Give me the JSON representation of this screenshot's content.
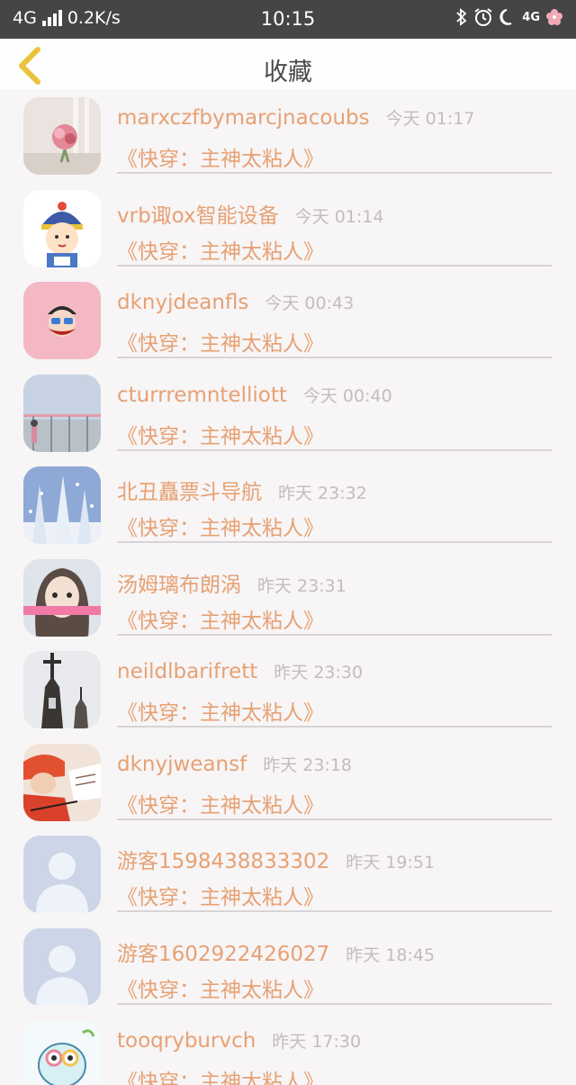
{
  "status_bar": {
    "network": "4G",
    "speed": "0.2K/s",
    "time": "10:15",
    "right_badge": "4G",
    "icons": [
      "bluetooth-icon",
      "alarm-icon",
      "moon-icon",
      "signal-4g-icon",
      "flower-icon"
    ]
  },
  "header": {
    "title": "收藏",
    "back_icon": "chevron-left-icon"
  },
  "colors": {
    "accent": "#e7a174",
    "time_gray": "#c2bcbd",
    "status_bar": "#454545"
  },
  "items": [
    {
      "name": "marxczfbymarcjnacoubs",
      "time": "今天 01:17",
      "book": "《快穿：主神太粘人》",
      "avatar": "flower-bouquet"
    },
    {
      "name": "vrb诹ox智能设备",
      "time": "今天 01:14",
      "book": "《快穿：主神太粘人》",
      "avatar": "cartoon-boy"
    },
    {
      "name": "dknyjdeanfls",
      "time": "今天 00:43",
      "book": "《快穿：主神太粘人》",
      "avatar": "pink-monkey"
    },
    {
      "name": "cturrremntelliott",
      "time": "今天 00:40",
      "book": "《快穿：主神太粘人》",
      "avatar": "seaside-girl"
    },
    {
      "name": "北丑矗票斗导航",
      "time": "昨天 23:32",
      "book": "《快穿：主神太粘人》",
      "avatar": "snowy-trees"
    },
    {
      "name": "汤姆璃布朗涡",
      "time": "昨天 23:31",
      "book": "《快穿：主神太粘人》",
      "avatar": "girl-portrait"
    },
    {
      "name": "neildlbarifrett",
      "time": "昨天 23:30",
      "book": "《快穿：主神太粘人》",
      "avatar": "church-steeple"
    },
    {
      "name": "dknyjweansf",
      "time": "昨天 23:18",
      "book": "《快穿：主神太粘人》",
      "avatar": "red-hat-girl"
    },
    {
      "name": "游客1598438833302",
      "time": "昨天 19:51",
      "book": "《快穿：主神太粘人》",
      "avatar": "default-user"
    },
    {
      "name": "游客1602922426027",
      "time": "昨天 18:45",
      "book": "《快穿：主神太粘人》",
      "avatar": "default-user"
    },
    {
      "name": "tooqryburvch",
      "time": "昨天 17:30",
      "book": "《快穿：主神太粘人》",
      "avatar": "cartoon-cat"
    }
  ]
}
